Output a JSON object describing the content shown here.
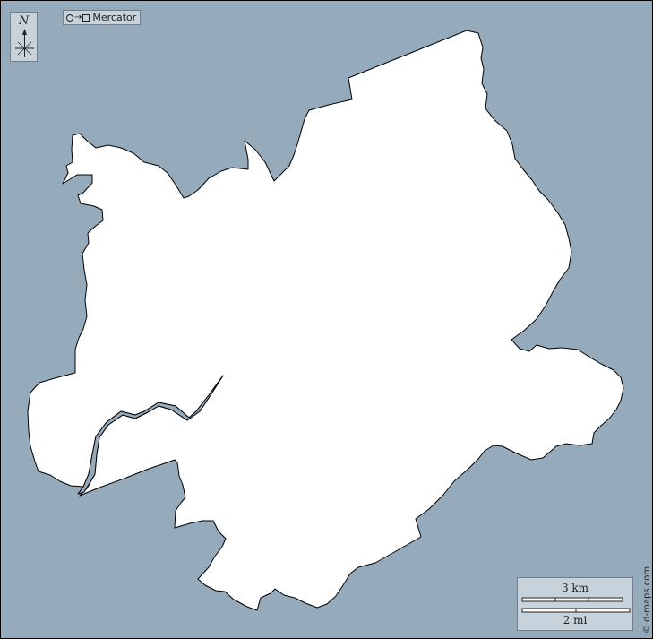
{
  "map": {
    "north_letter": "N",
    "projection_label": "Mercator",
    "projection_icons": [
      "circle-icon",
      "arrow-right-icon",
      "square-icon"
    ],
    "scale_km_label": "3 km",
    "scale_mi_label": "2 mi",
    "credit": "© d-maps.com",
    "colors": {
      "water": "#95abbc",
      "land": "#ffffff",
      "outline": "#000000",
      "panel": "#c8d2da"
    }
  }
}
